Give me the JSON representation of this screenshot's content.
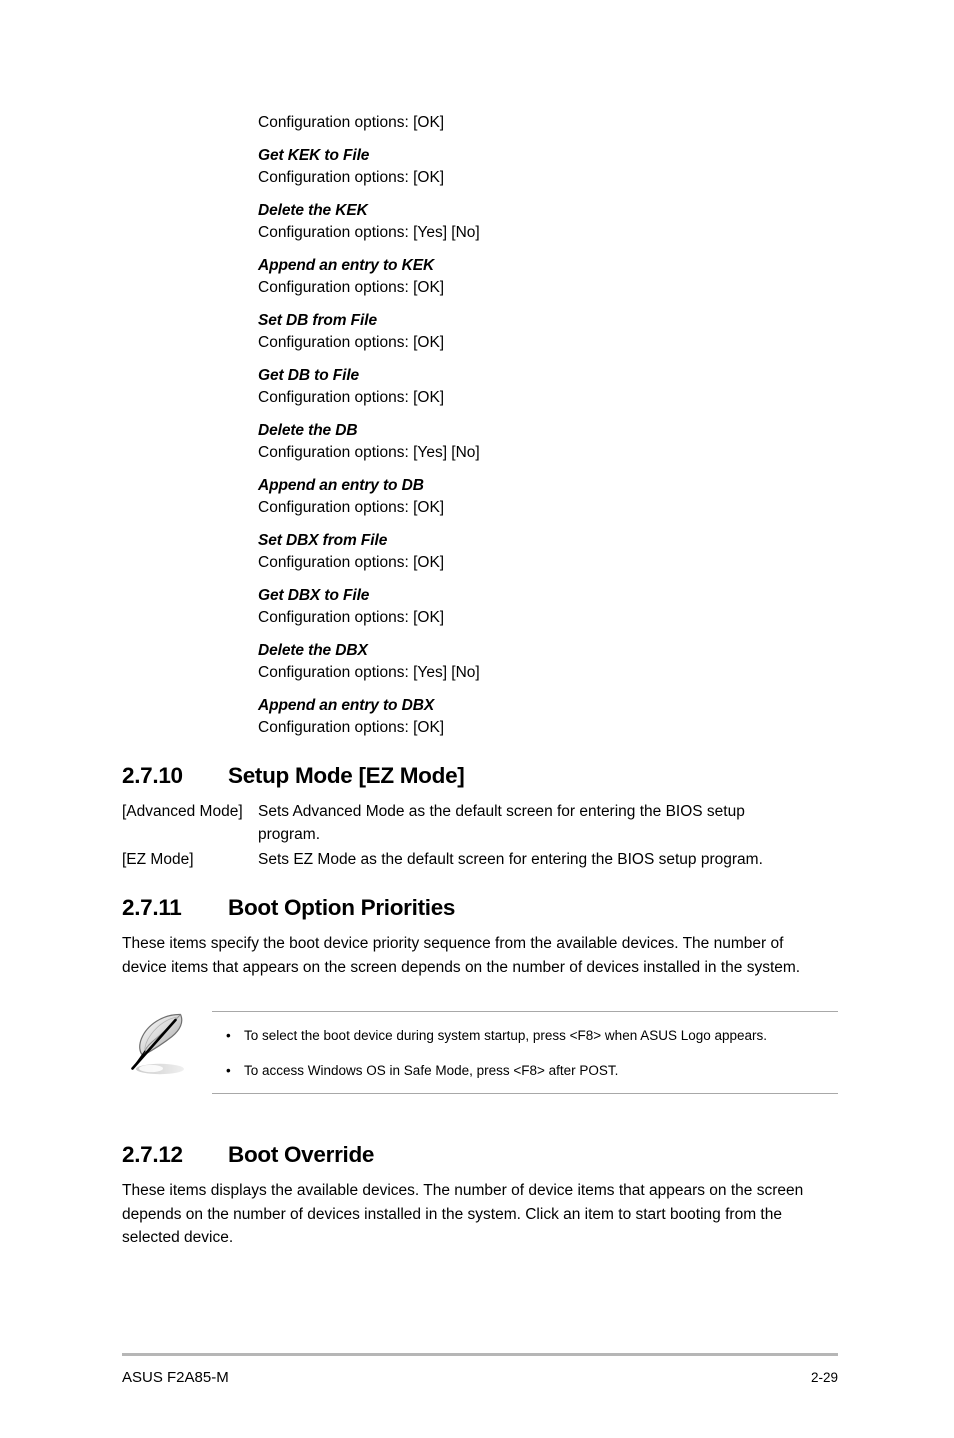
{
  "page": {
    "lead_config_line": "Configuration options: [OK]"
  },
  "bios_options": [
    {
      "name": "Get KEK to File",
      "config": "Configuration options: [OK]"
    },
    {
      "name": "Delete the KEK",
      "config": "Configuration options: [Yes] [No]"
    },
    {
      "name": "Append an entry to KEK",
      "config": "Configuration options: [OK]"
    },
    {
      "name": "Set DB from File",
      "config": "Configuration options: [OK]"
    },
    {
      "name": "Get DB to File",
      "config": "Configuration options: [OK]"
    },
    {
      "name": "Delete the DB",
      "config": "Configuration options: [Yes] [No]"
    },
    {
      "name": "Append an entry to DB",
      "config": "Configuration options: [OK]"
    },
    {
      "name": "Set DBX from File",
      "config": "Configuration options: [OK]"
    },
    {
      "name": "Get DBX to File",
      "config": "Configuration options: [OK]"
    },
    {
      "name": "Delete the DBX",
      "config": "Configuration options: [Yes] [No]"
    },
    {
      "name": "Append an entry to DBX",
      "config": "Configuration options: [OK]"
    }
  ],
  "section_2_7_10": {
    "number": "2.7.10",
    "title": "Setup Mode [EZ Mode]",
    "definitions": [
      {
        "term": "[Advanced Mode]",
        "desc": "Sets Advanced Mode as the default screen for entering the BIOS setup program."
      },
      {
        "term": "[EZ Mode]",
        "desc": "Sets EZ Mode as the default screen for entering the BIOS setup program."
      }
    ]
  },
  "section_2_7_11": {
    "number": "2.7.11",
    "title": "Boot Option Priorities",
    "paragraph": "These items specify the boot device priority sequence from the available devices. The number of device items that appears on the screen depends on the number of devices installed in the system.",
    "note": {
      "icon": "quill-pen-icon",
      "bullet_glyph": "•",
      "items": [
        "To select the boot device during system startup, press <F8> when ASUS Logo appears.",
        "To access Windows OS in Safe Mode, press <F8> after POST."
      ]
    }
  },
  "section_2_7_12": {
    "number": "2.7.12",
    "title": "Boot Override",
    "paragraph": "These items displays the available devices. The number of device items that appears on the screen depends on the number of devices installed in the system. Click an item to start booting from the selected device."
  },
  "footer": {
    "left": "ASUS F2A85-M",
    "right": "2-29"
  }
}
